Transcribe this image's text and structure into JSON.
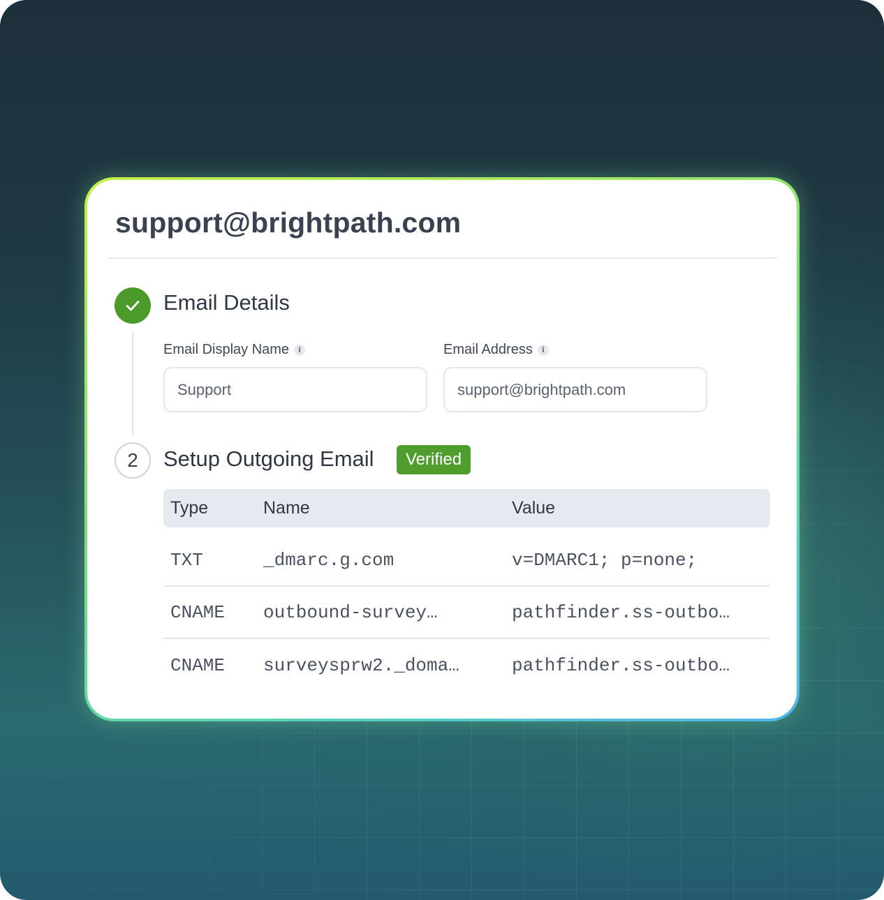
{
  "card": {
    "title": "support@brightpath.com"
  },
  "steps": [
    {
      "status": "completed",
      "icon": "check-icon",
      "title": "Email Details"
    },
    {
      "number": "2",
      "title": "Setup Outgoing Email",
      "badge": "Verified"
    }
  ],
  "form": {
    "display_name": {
      "label": "Email Display Name",
      "info_icon": "i",
      "value": "Support"
    },
    "email_address": {
      "label": "Email Address",
      "info_icon": "i",
      "value": "support@brightpath.com"
    }
  },
  "dns_table": {
    "columns": [
      "Type",
      "Name",
      "Value"
    ],
    "rows": [
      {
        "type": "TXT",
        "name": "_dmarc.g.com",
        "value": "v=DMARC1; p=none;"
      },
      {
        "type": "CNAME",
        "name": "outbound-survey…",
        "value": "pathfinder.ss-outbo…"
      },
      {
        "type": "CNAME",
        "name": "surveysprw2._doma…",
        "value": "pathfinder.ss-outbo…"
      }
    ]
  },
  "colors": {
    "success_green": "#4c9a2a",
    "badge_green": "#4e9d2d",
    "title_text": "#3a4252",
    "table_header_bg": "#e6eaf0"
  }
}
